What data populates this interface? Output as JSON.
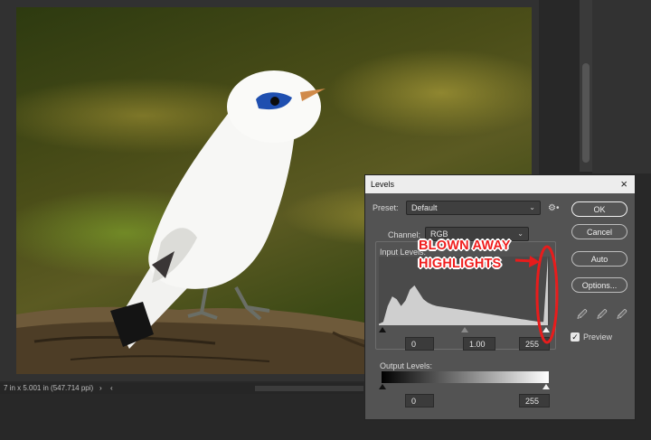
{
  "status_bar": {
    "text": "7 in x 5.001 in (547.714 ppi)",
    "next_arrow": "›",
    "prev_arrow": "‹"
  },
  "levels_dialog": {
    "title": "Levels",
    "close_icon": "×",
    "preset_label": "Preset:",
    "preset_value": "Default",
    "channel_label": "Channel:",
    "channel_value": "RGB",
    "input_levels_label": "Input Levels:",
    "input_levels": {
      "black": "0",
      "gamma": "1.00",
      "white": "255"
    },
    "output_levels_label": "Output Levels:",
    "output_levels": {
      "black": "0",
      "white": "255"
    },
    "buttons": {
      "ok": "OK",
      "cancel": "Cancel",
      "auto": "Auto",
      "options": "Options..."
    },
    "preview_label": "Preview",
    "preview_checked": true
  },
  "annotation": {
    "line1": "BLOWN AWAY",
    "line2": "HIGHLIGHTS",
    "color": "#e81c1c"
  },
  "histogram": {
    "values": [
      0.02,
      0.05,
      0.28,
      0.42,
      0.38,
      0.28,
      0.36,
      0.52,
      0.58,
      0.48,
      0.38,
      0.33,
      0.3,
      0.28,
      0.27,
      0.26,
      0.25,
      0.24,
      0.23,
      0.22,
      0.21,
      0.2,
      0.19,
      0.18,
      0.17,
      0.16,
      0.15,
      0.14,
      0.13,
      0.12,
      0.11,
      0.1,
      0.09,
      0.08,
      0.07,
      0.06,
      0.05,
      0.05,
      1.0
    ]
  }
}
